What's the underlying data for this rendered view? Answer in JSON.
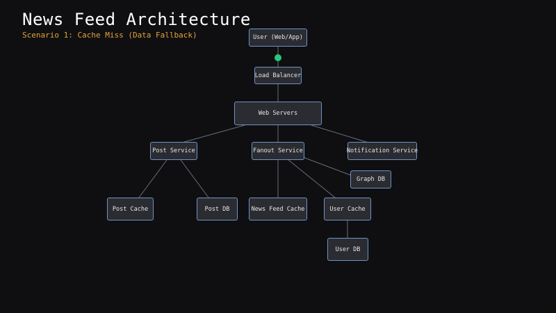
{
  "header": {
    "title": "News Feed Architecture",
    "subtitle": "Scenario 1: Cache Miss (Data Fallback)"
  },
  "colors": {
    "background": "#0f0f12",
    "node_fill": "#2a2c32",
    "node_border": "#6f94c4",
    "edge": "#6b6d75",
    "subtitle": "#e4a338",
    "request_dot": "#27c77c"
  },
  "nodes": {
    "user": "User (Web/App)",
    "load_balancer": "Load Balancer",
    "web_servers": "Web Servers",
    "post_service": "Post Service",
    "fanout_service": "Fanout Service",
    "notification_service": "Notification Service",
    "graph_db": "Graph DB",
    "post_cache": "Post Cache",
    "post_db": "Post DB",
    "news_feed_cache": "News Feed Cache",
    "user_cache": "User Cache",
    "user_db": "User DB"
  }
}
